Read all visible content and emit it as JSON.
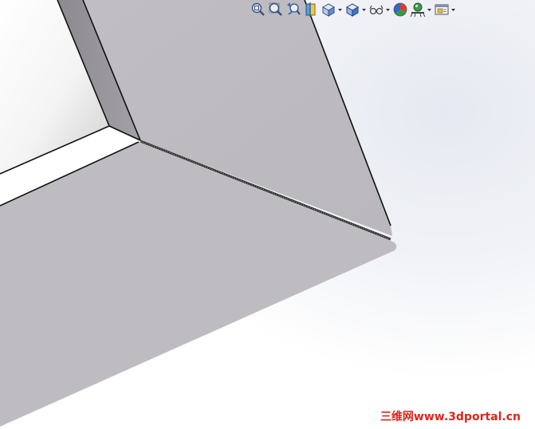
{
  "toolbar": {
    "buttons": [
      {
        "name": "zoom-to-fit-icon",
        "dropdown": false
      },
      {
        "name": "zoom-to-area-icon",
        "dropdown": false
      },
      {
        "name": "previous-view-icon",
        "dropdown": false
      },
      {
        "name": "section-view-icon",
        "dropdown": false
      },
      {
        "name": "view-orientation-icon",
        "dropdown": true
      },
      {
        "name": "display-style-icon",
        "dropdown": true
      },
      {
        "name": "hide-show-items-icon",
        "dropdown": true
      },
      {
        "name": "edit-appearance-icon",
        "dropdown": false
      },
      {
        "name": "apply-scene-icon",
        "dropdown": true
      },
      {
        "name": "view-settings-icon",
        "dropdown": true
      }
    ]
  },
  "colors": {
    "part_face": "#bdbbbf",
    "part_edge": "#101010",
    "background_highlight": "#e6e9f1",
    "watermark": "#e2231a"
  },
  "watermark": {
    "text": "三维网www.3dportal.cn"
  }
}
